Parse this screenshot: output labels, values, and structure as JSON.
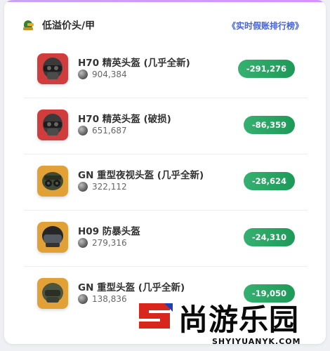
{
  "header": {
    "icon": "helmet-icon",
    "title": "低溢价头/甲",
    "link": "《实时假账排行榜》"
  },
  "items": [
    {
      "name": "H70 精英头盔 (几乎全新)",
      "price": "904,384",
      "change": "-291,276",
      "icon": "helmet-h70-icon",
      "bg": "#cf3d3d"
    },
    {
      "name": "H70 精英头盔 (破损)",
      "price": "651,687",
      "change": "-86,359",
      "icon": "helmet-h70-icon",
      "bg": "#cf3d3d"
    },
    {
      "name": "GN 重型夜视头盔 (几乎全新)",
      "price": "322,112",
      "change": "-28,624",
      "icon": "helmet-gn-nightvision-icon",
      "bg": "#e2a137"
    },
    {
      "name": "H09 防暴头盔",
      "price": "279,316",
      "change": "-24,310",
      "icon": "helmet-h09-riot-icon",
      "bg": "#e2a137"
    },
    {
      "name": "GN 重型头盔 (几乎全新)",
      "price": "138,836",
      "change": "-19,050",
      "icon": "helmet-gn-heavy-icon",
      "bg": "#e2a137"
    }
  ],
  "colors": {
    "accent": "#4663d9",
    "badge": "#22a05d",
    "watermark_red": "#d9261c",
    "watermark_blue": "#1d3fb8"
  },
  "watermark": {
    "text": "尚游乐园",
    "url": "SHYIYUANYK.COM"
  }
}
